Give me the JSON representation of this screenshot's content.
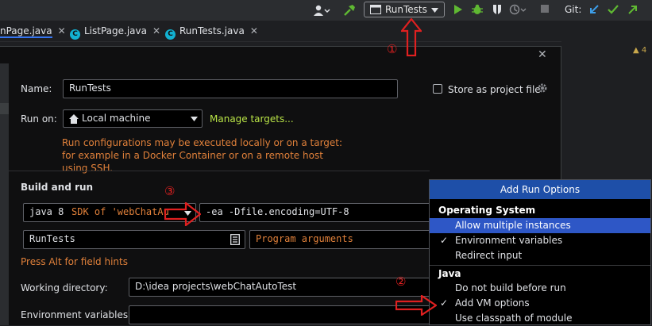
{
  "toolbar": {
    "run_config_label": "RunTests",
    "git_label": "Git:"
  },
  "tabs": [
    {
      "label": "nPage.java"
    },
    {
      "label": "ListPage.java"
    },
    {
      "label": "RunTests.java"
    }
  ],
  "warning_count": "4",
  "dialog": {
    "name_label": "Name:",
    "name_value": "RunTests",
    "store_label": "Store as project file",
    "run_on_label": "Run on:",
    "run_on_value": "Local machine",
    "manage_targets": "Manage targets...",
    "run_hint": "Run configurations may be executed locally or on a target: for example in a Docker Container or on a remote host using SSH.",
    "build_and_run": "Build and run",
    "jdk_prefix": "java 8",
    "jdk_value": "SDK of 'webChatAuto",
    "vm_options": "-ea -Dfile.encoding=UTF-8",
    "main_class": "RunTests",
    "program_args_placeholder": "Program arguments",
    "alt_hint": "Press Alt for field hints",
    "working_dir_label": "Working directory:",
    "working_dir_value": "D:\\idea projects\\webChatAutoTest",
    "env_vars_label": "Environment variables:"
  },
  "popup": {
    "title": "Add Run Options",
    "sections": [
      {
        "heading": "Operating System",
        "items": [
          {
            "label": "Allow multiple instances",
            "checked": false,
            "selected": true
          },
          {
            "label": "Environment variables",
            "checked": true,
            "selected": false
          },
          {
            "label": "Redirect input",
            "checked": false,
            "selected": false
          }
        ]
      },
      {
        "heading": "Java",
        "items": [
          {
            "label": "Do not build before run",
            "checked": false,
            "selected": false
          },
          {
            "label": "Add VM options",
            "checked": true,
            "selected": false
          },
          {
            "label": "Use classpath of module",
            "checked": false,
            "selected": false
          }
        ]
      }
    ]
  },
  "annotations": [
    "①",
    "②",
    "③"
  ],
  "colors": {
    "accent_link": "#b8e346",
    "hint_orange": "#e0803a",
    "popup_selected": "#2e57c6",
    "annotation_red": "#e02020"
  }
}
